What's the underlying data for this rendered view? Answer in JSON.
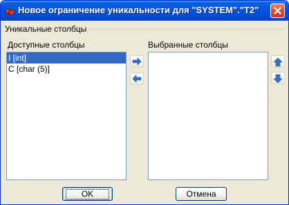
{
  "window": {
    "title": "Новое ограничение уникальности для \"SYSTEM\".\"T2\"",
    "icons": {
      "app": "app-icon",
      "close": "close-icon"
    }
  },
  "group": {
    "label": "Уникальные столбцы"
  },
  "available": {
    "label": "Доступные столбцы",
    "items": [
      {
        "text": "I [int]",
        "selected": true
      },
      {
        "text": "C [char (5)]",
        "selected": false
      }
    ]
  },
  "selected_columns": {
    "label": "Выбранные столбцы",
    "items": []
  },
  "move_buttons": {
    "add_icon": "arrow-right-icon",
    "remove_icon": "arrow-left-icon"
  },
  "order_buttons": {
    "up_icon": "arrow-up-icon",
    "down_icon": "arrow-down-icon"
  },
  "buttons": {
    "ok": "OK",
    "cancel": "Отмена"
  },
  "colors": {
    "title_bar": "#0053e3",
    "selection": "#316ac5",
    "dialog_bg": "#ece9d8",
    "arrow_blue": "#2c74d4"
  }
}
